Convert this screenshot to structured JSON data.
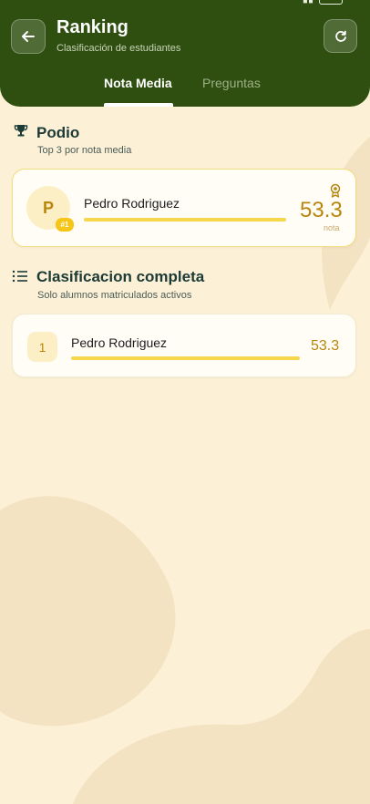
{
  "colors": {
    "header_bg": "#2f4f10",
    "page_bg": "#fcf1d6",
    "accent_gold": "#b8860b",
    "bar_fill": "#f6d64a",
    "badge_yellow": "#f5c518",
    "section_title": "#1c3a36"
  },
  "icons": {
    "back": "arrow-left-icon",
    "refresh": "refresh-icon",
    "trophy": "trophy-icon",
    "list": "list-icon",
    "medal": "medal-icon"
  },
  "header": {
    "title": "Ranking",
    "subtitle": "Clasificación de estudiantes"
  },
  "tabs": [
    {
      "label": "Nota Media",
      "active": true
    },
    {
      "label": "Preguntas",
      "active": false
    }
  ],
  "podium": {
    "title": "Podio",
    "subtitle": "Top 3 por nota media",
    "entries": [
      {
        "initial": "P",
        "rank_badge": "#1",
        "name": "Pedro Rodriguez",
        "score": "53.3",
        "unit": "nota",
        "progress": 1.0
      }
    ]
  },
  "full_ranking": {
    "title": "Clasificacion completa",
    "subtitle": "Solo alumnos matriculados activos",
    "entries": [
      {
        "position": "1",
        "name": "Pedro Rodriguez",
        "score": "53.3",
        "progress": 1.0
      }
    ]
  }
}
